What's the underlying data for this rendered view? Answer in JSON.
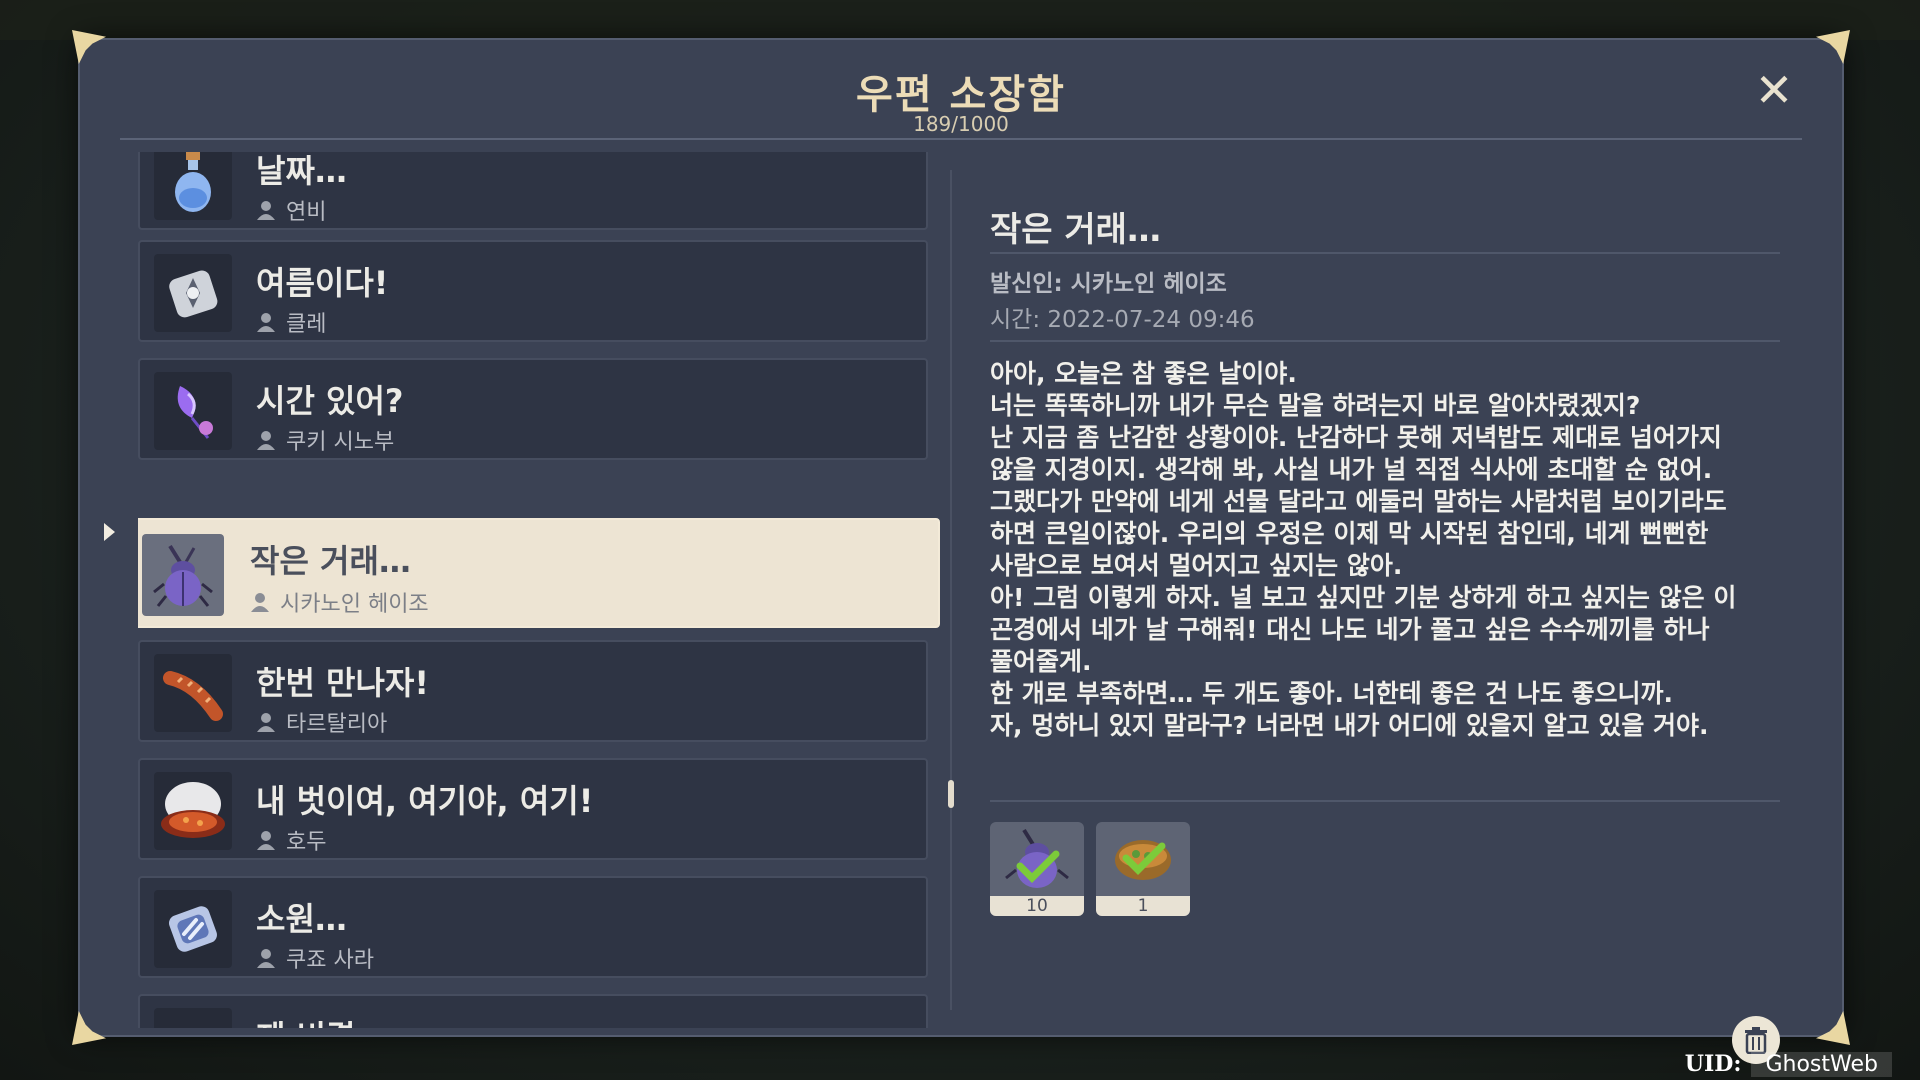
{
  "mailbox": {
    "title": "우편 소장함",
    "count": "189/1000"
  },
  "mails": [
    {
      "subject": "날짜…",
      "sender": "연비",
      "icon": "potion-icon"
    },
    {
      "subject": "여름이다!",
      "sender": "클레",
      "icon": "bomb-icon"
    },
    {
      "subject": "시간 있어?",
      "sender": "쿠키 시노부",
      "icon": "flower-icon"
    },
    {
      "subject": "작은 거래…",
      "sender": "시카노인 헤이조",
      "icon": "beetle-icon",
      "selected": true
    },
    {
      "subject": "한번 만나자!",
      "sender": "타르탈리아",
      "icon": "sausage-icon"
    },
    {
      "subject": "내 벗이여, 여기야, 여기!",
      "sender": "호두",
      "icon": "dish-icon"
    },
    {
      "subject": "소원…",
      "sender": "쿠죠 사라",
      "icon": "charm-icon"
    },
    {
      "subject": "제 비결…",
      "sender": "",
      "icon": "dango-icon"
    }
  ],
  "detail": {
    "title": "작은 거래…",
    "sender": "발신인: 시카노인 헤이조",
    "time": "시간: 2022-07-24 09:46",
    "body": [
      "아아, 오늘은 참 좋은 날이야.",
      "너는 똑똑하니까 내가 무슨 말을 하려는지 바로 알아차렸겠지?",
      "난 지금 좀 난감한 상황이야. 난감하다 못해 저녁밥도 제대로 넘어가지",
      "않을 지경이지. 생각해 봐, 사실 내가 널 직접 식사에 초대할 순 없어.",
      "그랬다가 만약에 네게 선물 달라고 에둘러 말하는 사람처럼 보이기라도",
      "하면 큰일이잖아. 우리의 우정은 이제 막 시작된 참인데, 네게 뻔뻔한",
      "사람으로 보여서 멀어지고 싶지는 않아.",
      "아! 그럼 이렇게 하자. 널 보고 싶지만 기분 상하게 하고 싶지는 않은 이",
      "곤경에서 네가 날 구해줘! 대신 나도 네가 풀고 싶은 수수께끼를 하나",
      "풀어줄게.",
      "한 개로 부족하면… 두 개도 좋아. 너한테 좋은 건 나도 좋으니까.",
      "자, 멍하니 있지 말라구? 너라면 내가 어디에 있을지 알고 있을 거야."
    ],
    "rewards": [
      {
        "icon": "beetle-icon",
        "qty": "10",
        "claimed": true
      },
      {
        "icon": "soup-bowl-icon",
        "qty": "1",
        "claimed": true
      }
    ]
  },
  "footer": {
    "uid_label": "UID:",
    "uid_value": "GhostWeb"
  },
  "colors": {
    "panel": "#3b4254",
    "title_gold": "#ecdcb7",
    "selected_bg": "#ede4d3",
    "check_green": "#7ccb3a"
  }
}
